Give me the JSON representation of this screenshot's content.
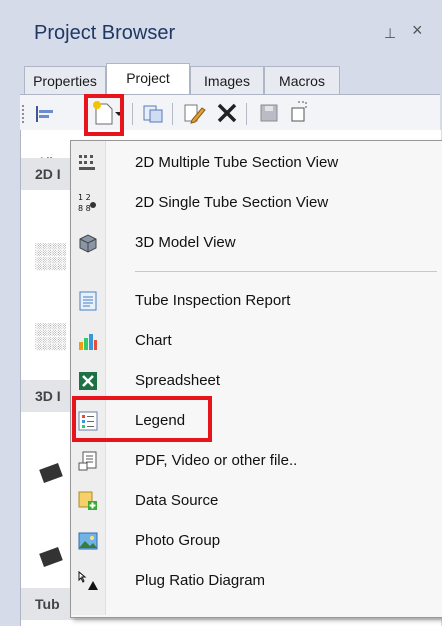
{
  "panel": {
    "title": "Project Browser",
    "pin_glyph": "⊥",
    "close_glyph": "×"
  },
  "tabs": [
    {
      "label": "Properties",
      "active": false
    },
    {
      "label": "Project",
      "active": true
    },
    {
      "label": "Images",
      "active": false
    },
    {
      "label": "Macros",
      "active": false
    }
  ],
  "toolbar": {
    "icons": [
      "align-icon",
      "new-item-icon",
      "dropdown-arrow-icon",
      "copy-icon",
      "edit-icon",
      "delete-icon",
      "save-icon",
      "add-link-icon"
    ]
  },
  "content": {
    "all_groups_label": "All g",
    "sections": [
      "2D I",
      "3D I",
      "Tub"
    ]
  },
  "menu": {
    "items": [
      {
        "label": "2D Multiple Tube Section View",
        "icon": "multi-tube-section-icon"
      },
      {
        "label": "2D Single Tube Section View",
        "icon": "single-tube-section-icon"
      },
      {
        "label": "3D Model View",
        "icon": "3d-model-icon"
      },
      {
        "label": "Tube Inspection Report",
        "icon": "report-icon"
      },
      {
        "label": "Chart",
        "icon": "chart-icon"
      },
      {
        "label": "Spreadsheet",
        "icon": "spreadsheet-icon"
      },
      {
        "label": "Legend",
        "icon": "legend-icon",
        "highlighted": true
      },
      {
        "label": "PDF, Video or other file..",
        "icon": "file-icon"
      },
      {
        "label": "Data Source",
        "icon": "data-source-icon"
      },
      {
        "label": "Photo Group",
        "icon": "photo-icon"
      },
      {
        "label": "Plug Ratio Diagram",
        "icon": "plug-ratio-icon"
      }
    ]
  },
  "colors": {
    "highlight": "#e8141c",
    "title": "#1f3864",
    "panel_bg": "#d6dbe9"
  }
}
